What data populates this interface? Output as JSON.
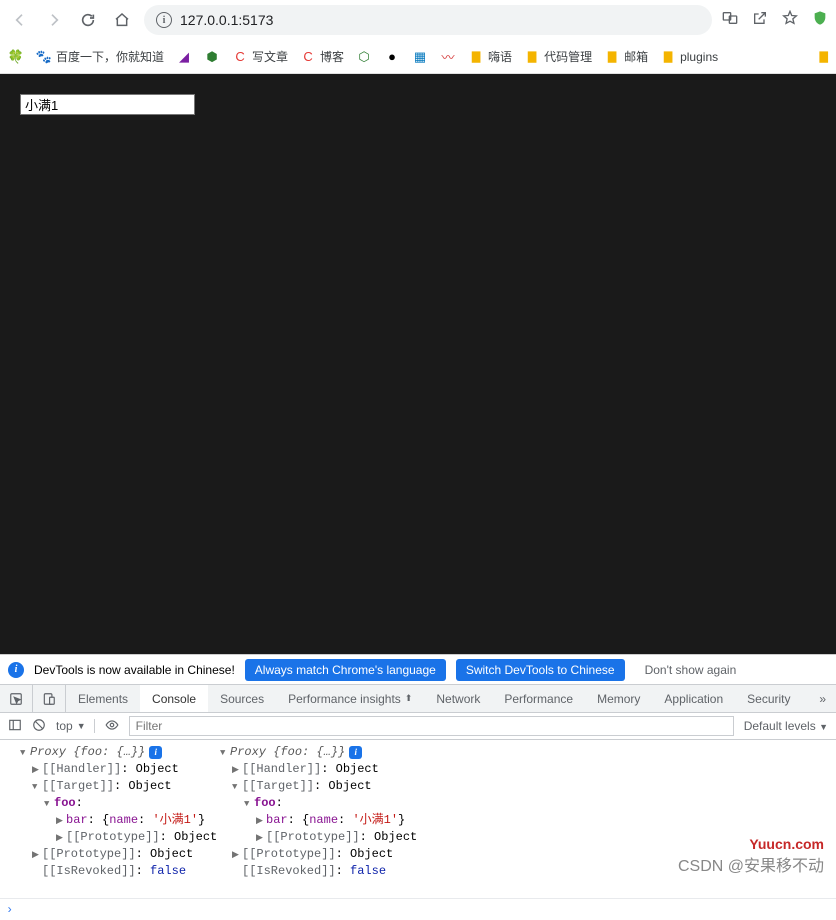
{
  "address": {
    "url": "127.0.0.1:5173"
  },
  "bookmarks": [
    {
      "icon": "🍀",
      "color": "#2e7d32",
      "label": ""
    },
    {
      "icon": "🐾",
      "color": "#1a73e8",
      "label": "百度一下，你就知道"
    },
    {
      "icon": "◢",
      "color": "#7b1fa2",
      "label": ""
    },
    {
      "icon": "⬢",
      "color": "#2e7d32",
      "label": ""
    },
    {
      "icon": "C",
      "color": "#e53935",
      "label": "写文章"
    },
    {
      "icon": "C",
      "color": "#e53935",
      "label": "博客"
    },
    {
      "icon": "⬡",
      "color": "#2e7d32",
      "label": ""
    },
    {
      "icon": "●",
      "color": "#000",
      "label": ""
    },
    {
      "icon": "▦",
      "color": "#0277bd",
      "label": ""
    },
    {
      "icon": "〰",
      "color": "#d32f2f",
      "label": ""
    },
    {
      "icon": "📁",
      "folder": true,
      "label": "嗨语"
    },
    {
      "icon": "📁",
      "folder": true,
      "label": "代码管理"
    },
    {
      "icon": "📁",
      "folder": true,
      "label": "邮箱"
    },
    {
      "icon": "📁",
      "folder": true,
      "label": "plugins"
    }
  ],
  "page": {
    "input_value": "小满1"
  },
  "devtools": {
    "banner_text": "DevTools is now available in Chinese!",
    "btn_match": "Always match Chrome's language",
    "btn_switch": "Switch DevTools to Chinese",
    "btn_dismiss": "Don't show again",
    "tabs": [
      "Elements",
      "Console",
      "Sources",
      "Performance insights",
      "Network",
      "Performance",
      "Memory",
      "Application",
      "Security"
    ],
    "active_tab": "Console",
    "context": "top",
    "filter_placeholder": "Filter",
    "levels": "Default levels"
  },
  "console": {
    "proxy_label": "Proxy",
    "foo_preview": "{foo: {…}}",
    "handler": "[[Handler]]",
    "target": "[[Target]]",
    "prototype": "[[Prototype]]",
    "isrevoked": "[[IsRevoked]]",
    "object": "Object",
    "foo": "foo",
    "bar": "bar",
    "name": "name",
    "bar_value": "'小满1'",
    "false": "false"
  },
  "watermark": {
    "line1": "Yuucn.com",
    "line2": "CSDN @安果移不动"
  }
}
